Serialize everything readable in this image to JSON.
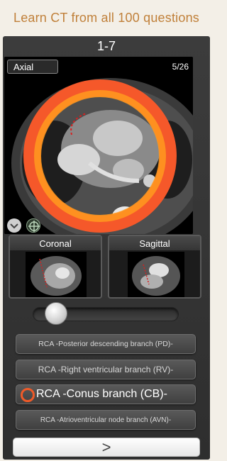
{
  "banner": {
    "text": "Learn CT from all 100 questions"
  },
  "question": {
    "number": "1-7"
  },
  "viewer": {
    "view_label": "Axial",
    "slice_counter": "5/26"
  },
  "thumbnails": [
    {
      "label": "Coronal"
    },
    {
      "label": "Sagittal"
    }
  ],
  "slider": {
    "position": 0.1
  },
  "answers": [
    {
      "label": "RCA -Posterior descending branch (PD)-",
      "selected": false
    },
    {
      "label": "RCA -Right ventricular branch (RV)-",
      "selected": false
    },
    {
      "label": "RCA -Conus branch (CB)-",
      "selected": true
    },
    {
      "label": "RCA -Atrioventricular node branch (AVN)-",
      "selected": false
    }
  ],
  "next_button": {
    "label": ">"
  },
  "icons": {
    "chevron": "chevron-down-icon",
    "crosshair": "crosshair-icon",
    "highlight": "highlight-ring-icon"
  },
  "colors": {
    "banner_text": "#c0803a",
    "highlight_outer": "#f5582a",
    "highlight_inner": "#ff9a1f",
    "selected_ring": "#f05a28"
  }
}
